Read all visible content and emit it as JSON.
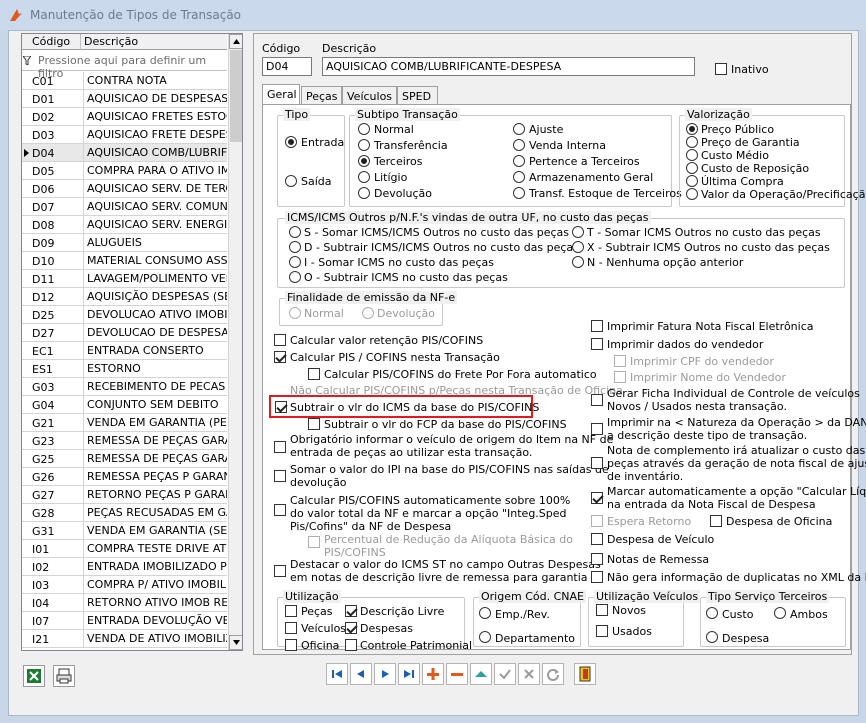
{
  "window": {
    "title": "Manutenção de Tipos de Transação"
  },
  "grid": {
    "headers": {
      "code": "Código",
      "desc": "Descrição"
    },
    "filter_placeholder": "Pressione aqui para definir um filtro",
    "rows": [
      {
        "code": "C01",
        "desc": "CONTRA NOTA"
      },
      {
        "code": "D01",
        "desc": "AQUISICAO DE DESPESAS DIV"
      },
      {
        "code": "D02",
        "desc": "AQUISICAO FRETES ESTOQUE"
      },
      {
        "code": "D03",
        "desc": "AQUISICAO FRETE DESPESA"
      },
      {
        "code": "D04",
        "desc": "AQUISICAO COMB/LUBRIFICA"
      },
      {
        "code": "D05",
        "desc": "COMPRA PARA O ATIVO IMOB"
      },
      {
        "code": "D06",
        "desc": "AQUISICAO SERV. DE TERCEIF"
      },
      {
        "code": "D07",
        "desc": "AQUISICAO SERV. COMUNICA"
      },
      {
        "code": "D08",
        "desc": "AQUISICAO SERV. ENERGIA El"
      },
      {
        "code": "D09",
        "desc": "ALUGUEIS"
      },
      {
        "code": "D10",
        "desc": "MATERIAL CONSUMO ASSIST T"
      },
      {
        "code": "D11",
        "desc": "LAVAGEM/POLIMENTO VEICULO"
      },
      {
        "code": "D12",
        "desc": "AQUISIÇÃO DESPESAS (SERVI"
      },
      {
        "code": "D25",
        "desc": "DEVOLUCAO ATIVO IMOBILIZA"
      },
      {
        "code": "D27",
        "desc": "DEVOLUCAO DE DESPESAS"
      },
      {
        "code": "EC1",
        "desc": "ENTRADA CONSERTO"
      },
      {
        "code": "ES1",
        "desc": "ESTORNO"
      },
      {
        "code": "G03",
        "desc": "RECEBIMENTO DE PECAS GAR/"
      },
      {
        "code": "G04",
        "desc": "CONJUNTO SEM DEBITO"
      },
      {
        "code": "G21",
        "desc": "VENDA EM GARANTIA (PEÇAS)"
      },
      {
        "code": "G23",
        "desc": "REMESSA DE PEÇAS GARANTI/"
      },
      {
        "code": "G25",
        "desc": "REMESSA DE PEÇAS GARANTIA"
      },
      {
        "code": "G26",
        "desc": "REMESSA PEÇAS P GARANTIA-"
      },
      {
        "code": "G27",
        "desc": "RETORNO PEÇAS P GARANTIA"
      },
      {
        "code": "G28",
        "desc": "PEÇAS RECUSADAS EM GARAN"
      },
      {
        "code": "G31",
        "desc": "VENDA EM GARANTIA (SERVIÇ"
      },
      {
        "code": "I01",
        "desc": "COMPRA TESTE DRIVE ATIVO I"
      },
      {
        "code": "I02",
        "desc": "ENTRADA IMOBILIZADO POR T"
      },
      {
        "code": "I03",
        "desc": "COMPRA P/ ATIVO IMOBILIZ. I"
      },
      {
        "code": "I04",
        "desc": "RETORNO ATIVO IMOB REMET"
      },
      {
        "code": "I07",
        "desc": "ENTRADA DEVOLUÇÃO VENDA"
      },
      {
        "code": "I21",
        "desc": "VENDA DE ATIVO IMOBILIZADO"
      }
    ]
  },
  "header": {
    "code_label": "Código",
    "code_value": "D04",
    "desc_label": "Descrição",
    "desc_value": "AQUISICAO COMB/LUBRIFICANTE-DESPESA",
    "inativo": "Inativo"
  },
  "tabs": [
    "Geral",
    "Peças",
    "Veículos",
    "SPED"
  ],
  "tipo": {
    "title": "Tipo",
    "entrada": "Entrada",
    "saida": "Saída"
  },
  "subtipo": {
    "title": "Subtipo Transação",
    "items": [
      "Normal",
      "Transferência",
      "Terceiros",
      "Litígio",
      "Devolução",
      "Ajuste",
      "Venda Interna",
      "Pertence a Terceiros",
      "Armazenamento Geral",
      "Transf. Estoque de Terceiros"
    ]
  },
  "valorizacao": {
    "title": "Valorização",
    "items": [
      "Preço Público",
      "Preço de Garantia",
      "Custo Médio",
      "Custo de Reposição",
      "Última Compra",
      "Valor da Operação/Precificação"
    ]
  },
  "icms": {
    "title": "ICMS/ICMS Outros p/N.F.'s vindas de outra UF, no custo das peças",
    "items": [
      "S - Somar ICMS/ICMS Outros no custo das peças",
      "D - Subtrair ICMS/ICMS Outros no custo das peças",
      "I - Somar ICMS no custo das peças",
      "O - Subtrair ICMS no custo das peças",
      "T - Somar ICMS Outros no custo das peças",
      "X - Subtrair ICMS Outros no custo das peças",
      "N - Nenhuma opção anterior"
    ]
  },
  "finalidade": {
    "title": "Finalidade de emissão da NF-e",
    "normal": "Normal",
    "devolucao": "Devolução"
  },
  "left_opts": {
    "a": "Calcular valor retenção PIS/COFINS",
    "b": "Calcular PIS / COFINS nesta Transação",
    "c": "Calcular PIS/COFINS do Frete Por Fora automatico",
    "d": "Não Calcular PIS/COFINS p/Peças nesta Transação de Oficina",
    "e": "Subtrair o vlr do ICMS da base do PIS/COFINS",
    "f": "Subtrair o vlr do FCP da base do PIS/COFINS",
    "g1": "Obrigatório informar o veículo de origem do Item na NF de",
    "g2": "entrada de peças ao utilizar esta transação.",
    "h1": "Somar o valor do IPI na base do PIS/COFINS nas saídas de",
    "h2": "devolução",
    "i1": "Calcular PIS/COFINS automaticamente sobre 100%",
    "i2": "do valor total da NF e marcar a opção \"Integ.Sped",
    "i3": "Pis/Cofins\" da NF de Despesa",
    "j1": "Percentual de Redução da Alíquota Básica do",
    "j2": "PIS/COFINS",
    "k1": "Destacar o valor do ICMS ST no campo Outras Despesas",
    "k2": "em notas de descrição livre de remessa para garantia"
  },
  "right_opts": {
    "a": "Imprimir Fatura Nota Fiscal Eletrônica",
    "b": "Imprimir dados do vendedor",
    "c": "Imprimir CPF do vendedor",
    "d": "Imprimir Nome do Vendedor",
    "e1": "Gerar Ficha Individual de Controle de veículos",
    "e2": "Novos / Usados  nesta transação.",
    "f1": "Imprimir na < Natureza da Operação > da DANFE,",
    "f2": "a descrição deste tipo de transação.",
    "g1": "Nota de complemento irá atualizar o custo das",
    "g2": "peças através da geração de nota fiscal de ajuste",
    "g3": "de inventário.",
    "h1": "Marcar automaticamente a opção \"Calcular Líquido\"",
    "h2": "na entrada da Nota Fiscal de Despesa",
    "i": "Espera Retorno",
    "j": "Despesa de Oficina",
    "k": "Despesa de Veículo",
    "l": "Notas de Remessa",
    "m": "Não gera informação de duplicatas no XML da NFe"
  },
  "utilizacao": {
    "title": "Utilização",
    "items": [
      "Peças",
      "Veículos",
      "Oficina",
      "Descrição Livre",
      "Despesas",
      "Controle Patrimonial"
    ]
  },
  "origem": {
    "title": "Origem Cód. CNAE",
    "items": [
      "Emp./Rev.",
      "Departamento"
    ]
  },
  "util_veic": {
    "title": "Utilização Veículos",
    "items": [
      "Novos",
      "Usados"
    ]
  },
  "tipo_serv": {
    "title": "Tipo Serviço Terceiros",
    "items": [
      "Custo",
      "Ambos",
      "Despesa"
    ]
  },
  "colors": {
    "accent": "#e01b1b",
    "nav_blue": "#1a5fb4"
  }
}
